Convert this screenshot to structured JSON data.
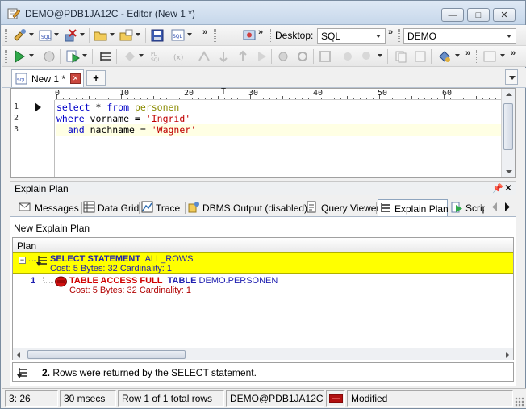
{
  "window": {
    "title": "DEMO@PDB1JA12C - Editor (New 1 *)",
    "controls": {
      "minimize": "—",
      "maximize": "□",
      "close": "✕"
    }
  },
  "toolbar": {
    "desktop_label": "Desktop:",
    "desktop_value": "SQL",
    "connection_value": "DEMO",
    "overflow": "»"
  },
  "editor_tabs": {
    "active_tab": "New 1 *",
    "add_tab": "+"
  },
  "ruler": {
    "labels": [
      "0",
      "10",
      "20",
      "30",
      "40",
      "50",
      "60"
    ]
  },
  "editor": {
    "line_numbers": [
      "1",
      "2",
      "3"
    ],
    "lines": [
      [
        {
          "t": "select",
          "c": "kw"
        },
        {
          "t": " * ",
          "c": ""
        },
        {
          "t": "from",
          "c": "kw"
        },
        {
          "t": " ",
          "c": ""
        },
        {
          "t": "personen",
          "c": "tbl"
        }
      ],
      [
        {
          "t": "where",
          "c": "kw"
        },
        {
          "t": " vorname = ",
          "c": ""
        },
        {
          "t": "'Ingrid'",
          "c": "str"
        }
      ],
      [
        {
          "t": "  ",
          "c": ""
        },
        {
          "t": "and",
          "c": "kw"
        },
        {
          "t": " nachname = ",
          "c": ""
        },
        {
          "t": "'Wagner'",
          "c": "str"
        }
      ]
    ]
  },
  "panel": {
    "title": "Explain Plan",
    "pin": "📌",
    "close": "✕",
    "tabs": [
      {
        "label": "Messages",
        "icon": "messages-icon"
      },
      {
        "label": "Data Grid",
        "icon": "grid-icon"
      },
      {
        "label": "Trace",
        "icon": "trace-icon"
      },
      {
        "label": "DBMS Output (disabled)",
        "icon": "dbms-output-icon"
      },
      {
        "label": "Query Viewer",
        "icon": "query-viewer-icon"
      },
      {
        "label": "Explain Plan",
        "icon": "explain-plan-icon"
      },
      {
        "label": "Scrip",
        "icon": "script-icon"
      }
    ],
    "selected_tab": "Explain Plan",
    "new_plan_label": "New Explain Plan",
    "plan_header": "Plan",
    "rows": [
      {
        "expander": "−",
        "number": "",
        "operation": "SELECT STATEMENT",
        "option": "ALL_ROWS",
        "object": "",
        "cost_line": "Cost: 5  Bytes: 32  Cardinality: 1"
      },
      {
        "expander": "",
        "number": "1",
        "operation": "TABLE ACCESS FULL",
        "option": "TABLE",
        "object": "DEMO.PERSONEN",
        "cost_line": "Cost: 5  Bytes: 32  Cardinality: 1"
      }
    ],
    "message_number": "2.",
    "message_text": "Rows were returned by the SELECT statement."
  },
  "status": {
    "cursor": "3:  26",
    "elapsed": "30 msecs",
    "rows": "Row 1 of 1 total rows",
    "connection": "DEMO@PDB1JA12C",
    "state": "Modified"
  },
  "colors": {
    "highlight_row": "#ffff00",
    "keyword": "#0000c8",
    "string": "#c00000",
    "table_name": "#8a8a00"
  }
}
